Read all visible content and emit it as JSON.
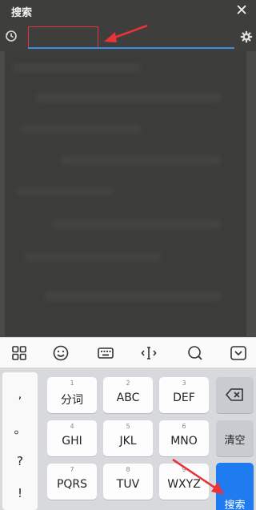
{
  "header": {
    "title": "搜索",
    "close_symbol": "✕"
  },
  "search": {
    "value": "",
    "placeholder": ""
  },
  "keyboard": {
    "punctuation": [
      ",",
      "。",
      "?",
      "!"
    ],
    "keys": [
      {
        "num": "1",
        "label": "分词"
      },
      {
        "num": "2",
        "label": "ABC"
      },
      {
        "num": "3",
        "label": "DEF"
      },
      {
        "num": "4",
        "label": "GHI"
      },
      {
        "num": "5",
        "label": "JKL"
      },
      {
        "num": "6",
        "label": "MNO"
      },
      {
        "num": "7",
        "label": "PQRS"
      },
      {
        "num": "8",
        "label": "TUV"
      },
      {
        "num": "9",
        "label": "WXYZ"
      }
    ],
    "clear_label": "清空",
    "search_label": "搜索"
  },
  "colors": {
    "accent": "#1e7cf0",
    "highlight": "#e8333a",
    "underline": "#3a8ee8"
  }
}
